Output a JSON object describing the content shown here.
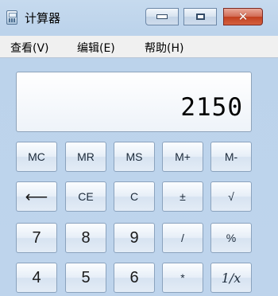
{
  "window": {
    "title": "计算器",
    "buttons": {
      "minimize": "minimize",
      "maximize": "maximize",
      "close": "✕"
    }
  },
  "menu": {
    "items": [
      "查看(V)",
      "编辑(E)",
      "帮助(H)"
    ]
  },
  "display": {
    "value": "2150"
  },
  "keypad": {
    "row1": [
      "MC",
      "MR",
      "MS",
      "M+",
      "M-"
    ],
    "row2": [
      "⟵",
      "CE",
      "C",
      "±",
      "√"
    ],
    "row3": [
      "7",
      "8",
      "9",
      "/",
      "%"
    ],
    "row4": [
      "4",
      "5",
      "6",
      "*",
      "1/x"
    ]
  },
  "colors": {
    "window_bg": "#c6daee",
    "close_button": "#c1401f"
  },
  "icons": [
    "calculator-app-icon",
    "minimize-icon",
    "maximize-icon",
    "close-icon",
    "backspace-icon"
  ]
}
